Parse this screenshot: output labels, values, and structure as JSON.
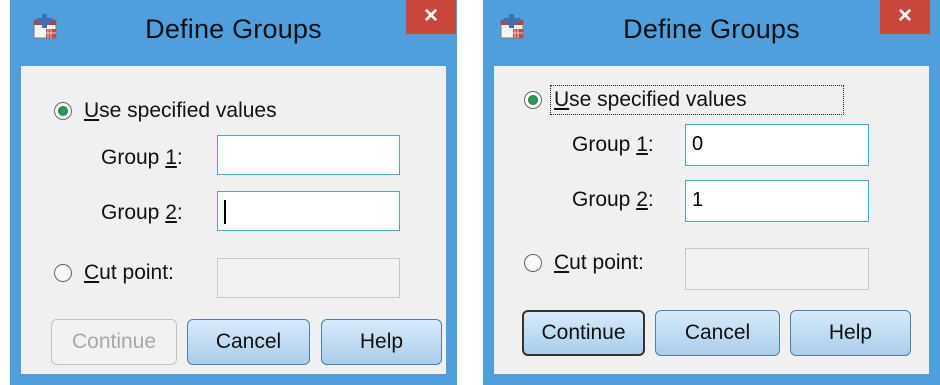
{
  "left_dialog": {
    "title": "Define Groups",
    "close_glyph": "×",
    "options": {
      "specified_values": {
        "label_underlined": "U",
        "label_rest": "se specified values",
        "checked": true
      },
      "cut_point": {
        "label_underlined": "C",
        "label_rest": "ut point:",
        "checked": false
      }
    },
    "group1": {
      "label_prefix": "Group ",
      "label_underlined": "1",
      "label_suffix": ":",
      "value": ""
    },
    "group2": {
      "label_prefix": "Group ",
      "label_underlined": "2",
      "label_suffix": ":",
      "value": ""
    },
    "cut_point_value": "",
    "buttons": {
      "continue": "Continue",
      "cancel": "Cancel",
      "help": "Help"
    }
  },
  "right_dialog": {
    "title": "Define Groups",
    "close_glyph": "×",
    "options": {
      "specified_values": {
        "label_underlined": "U",
        "label_rest": "se specified values",
        "checked": true
      },
      "cut_point": {
        "label_underlined": "C",
        "label_rest": "ut point:",
        "checked": false
      }
    },
    "group1": {
      "label_prefix": "Group ",
      "label_underlined": "1",
      "label_suffix": ":",
      "value": "0"
    },
    "group2": {
      "label_prefix": "Group ",
      "label_underlined": "2",
      "label_suffix": ":",
      "value": "1"
    },
    "cut_point_value": "",
    "buttons": {
      "continue": "Continue",
      "cancel": "Cancel",
      "help": "Help"
    }
  },
  "colors": {
    "frame": "#4f9fdc",
    "close_button": "#c9463d",
    "client_bg": "#f0f0f0",
    "radio_checked": "#2e9a56",
    "input_border": "#4da3e0"
  },
  "icons": {
    "app_icon": "spss-dialog-icon",
    "close": "close-icon"
  }
}
